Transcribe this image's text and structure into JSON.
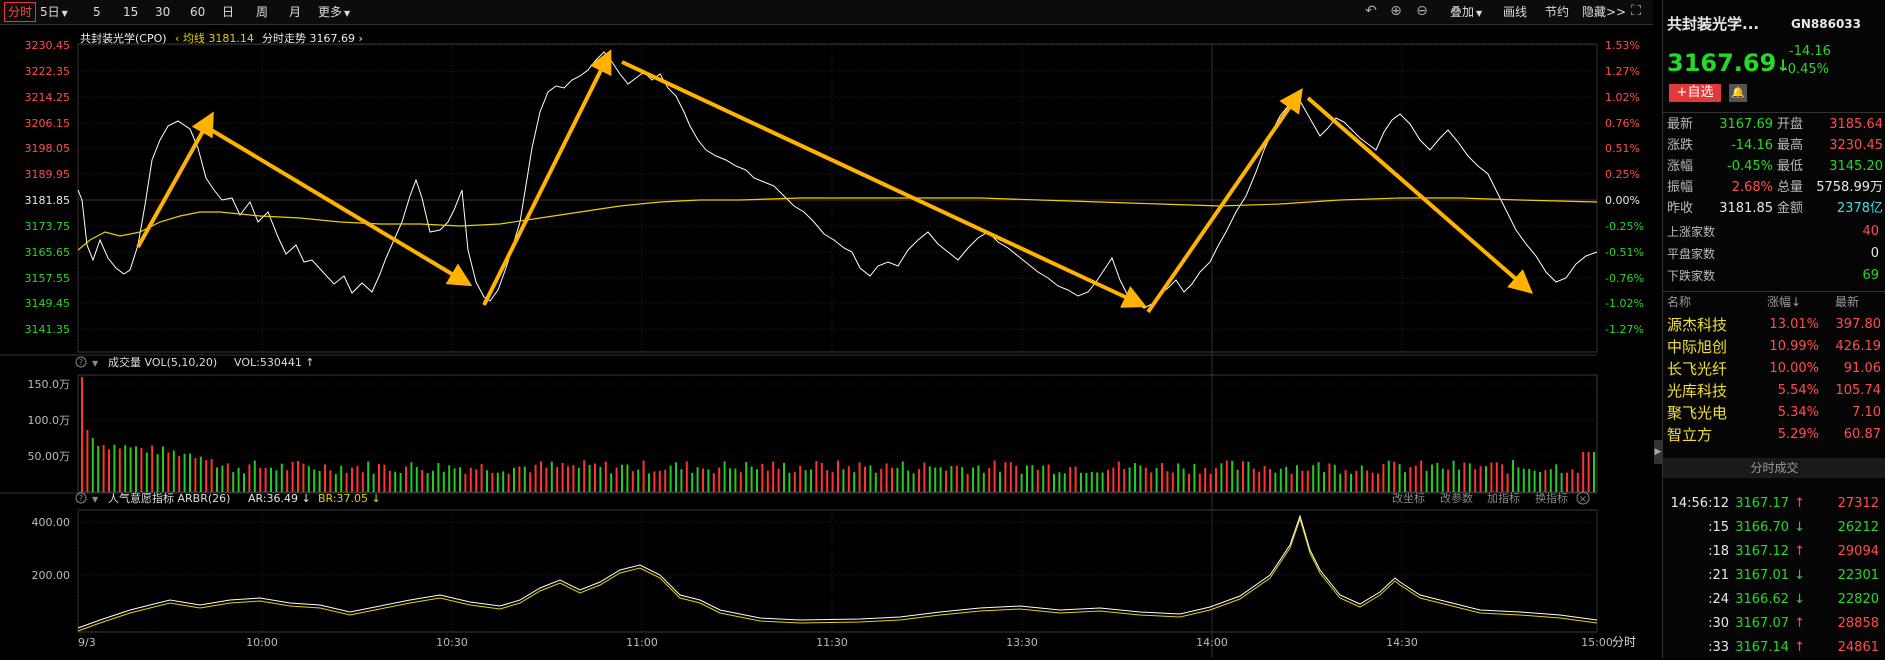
{
  "toolbar": {
    "tabs": [
      {
        "label": "分时",
        "active": true
      },
      {
        "label": "5日",
        "caret": true
      },
      {
        "label": "5"
      },
      {
        "label": "15"
      },
      {
        "label": "30"
      },
      {
        "label": "60"
      },
      {
        "label": "日"
      },
      {
        "label": "周"
      },
      {
        "label": "月"
      },
      {
        "label": "更多",
        "caret": true
      }
    ],
    "right_items": [
      "叠加",
      "画线",
      "节约",
      "隐藏>>"
    ]
  },
  "main_chart": {
    "title": "共封装光学(CPO)",
    "avg_label": "均线",
    "avg_value": "3181.14",
    "trend_label": "分时走势",
    "trend_value": "3167.69",
    "y_left": [
      "3230.45",
      "3222.35",
      "3214.25",
      "3206.15",
      "3198.05",
      "3189.95",
      "3181.85",
      "3173.75",
      "3165.65",
      "3157.55",
      "3149.45",
      "3141.35"
    ],
    "y_right": [
      "1.53%",
      "1.27%",
      "1.02%",
      "0.76%",
      "0.51%",
      "0.25%",
      "0.00%",
      "-0.25%",
      "-0.51%",
      "-0.76%",
      "-1.02%",
      "-1.27%"
    ]
  },
  "volume_panel": {
    "title": "成交量 VOL(5,10,20)",
    "vol_label": "VOL:530441",
    "y_labels": [
      "150.0万",
      "100.0万",
      "50.00万"
    ]
  },
  "indicator_panel": {
    "title": "人气意愿指标 ARBR(26)",
    "ar_label": "AR:36.49",
    "br_label": "BR:37.05",
    "buttons": [
      "改坐标",
      "改参数",
      "加指标",
      "换指标"
    ],
    "y_labels": [
      "400.00",
      "200.00"
    ]
  },
  "x_axis": {
    "labels": [
      "9/3",
      "10:00",
      "10:30",
      "11:00",
      "11:30",
      "13:30",
      "14:00",
      "14:30",
      "15:00"
    ],
    "unit": "分时"
  },
  "quote": {
    "name": "共封装光学...",
    "code": "GN886033",
    "price": "3167.69",
    "change": "-14.16",
    "change_pct": "-0.45%",
    "watch_button": "+自选",
    "rows": [
      {
        "l1": "最新",
        "v1": "3167.69",
        "c1": "green",
        "l2": "开盘",
        "v2": "3185.64",
        "c2": "red"
      },
      {
        "l1": "涨跌",
        "v1": "-14.16",
        "c1": "green",
        "l2": "最高",
        "v2": "3230.45",
        "c2": "red"
      },
      {
        "l1": "涨幅",
        "v1": "-0.45%",
        "c1": "green",
        "l2": "最低",
        "v2": "3145.20",
        "c2": "green"
      },
      {
        "l1": "振幅",
        "v1": "2.68%",
        "c1": "red",
        "l2": "总量",
        "v2": "5758.99万",
        "c2": "white"
      },
      {
        "l1": "昨收",
        "v1": "3181.85",
        "c1": "white",
        "l2": "金额",
        "v2": "2378亿",
        "c2": "cyan"
      }
    ],
    "counts": [
      {
        "label": "上涨家数",
        "value": "40",
        "color": "red"
      },
      {
        "label": "平盘家数",
        "value": "0",
        "color": "white"
      },
      {
        "label": "下跌家数",
        "value": "69",
        "color": "green"
      }
    ]
  },
  "stocks": {
    "headers": [
      "名称",
      "涨幅",
      "最新"
    ],
    "rows": [
      {
        "name": "源杰科技",
        "pct": "13.01%",
        "price": "397.80"
      },
      {
        "name": "中际旭创",
        "pct": "10.99%",
        "price": "426.19"
      },
      {
        "name": "长飞光纤",
        "pct": "10.00%",
        "price": "91.06"
      },
      {
        "name": "光库科技",
        "pct": "5.54%",
        "price": "105.74"
      },
      {
        "name": "聚飞光电",
        "pct": "5.34%",
        "price": "7.10"
      },
      {
        "name": "智立方",
        "pct": "5.29%",
        "price": "60.87"
      }
    ]
  },
  "ticks": {
    "title": "分时成交",
    "rows": [
      {
        "time": "14:56:12",
        "price": "3167.17",
        "dir": "up",
        "vol": "27312"
      },
      {
        "time": ":15",
        "price": "3166.70",
        "dir": "down",
        "vol": "26212"
      },
      {
        "time": ":18",
        "price": "3167.12",
        "dir": "up",
        "vol": "29094"
      },
      {
        "time": ":21",
        "price": "3167.01",
        "dir": "down",
        "vol": "22301"
      },
      {
        "time": ":24",
        "price": "3166.62",
        "dir": "down",
        "vol": "22820"
      },
      {
        "time": ":30",
        "price": "3167.07",
        "dir": "up",
        "vol": "28858"
      },
      {
        "time": ":33",
        "price": "3167.14",
        "dir": "up",
        "vol": "24861"
      }
    ]
  },
  "colors": {
    "up": "#ff4d4d",
    "down": "#27d927",
    "avg": "#e6d200",
    "price": "#ffffff",
    "arrow": "#ffb300"
  }
}
